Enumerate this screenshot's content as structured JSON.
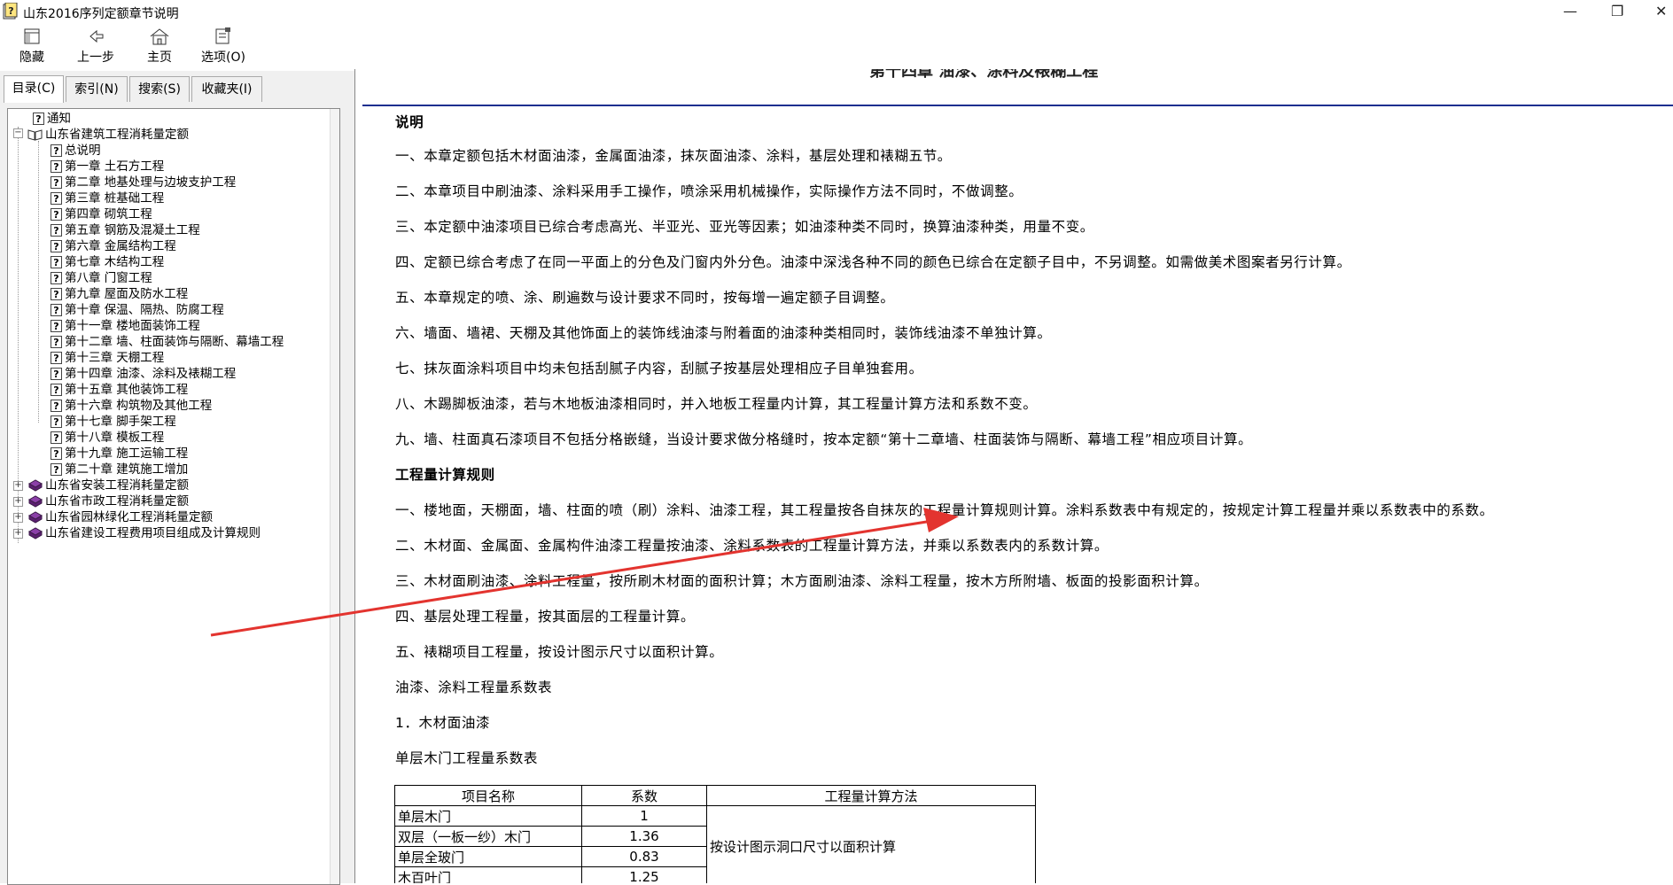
{
  "window": {
    "title": "山东2016序列定额章节说明",
    "controls": {
      "minimize": "—",
      "restore": "❐",
      "close": "✕"
    }
  },
  "toolbar": {
    "buttons": [
      {
        "label": "隐藏",
        "icon": "hide-icon"
      },
      {
        "label": "上一步",
        "icon": "back-arrow-icon"
      },
      {
        "label": "主页",
        "icon": "home-icon"
      },
      {
        "label": "选项(O)",
        "icon": "options-icon"
      }
    ]
  },
  "tabs": [
    "目录(C)",
    "索引(N)",
    "搜索(S)",
    "收藏夹(I)"
  ],
  "tree": {
    "notice": "通知",
    "root_open": "山东省建筑工程消耗量定额",
    "children": [
      "总说明",
      "第一章  土石方工程",
      "第二章  地基处理与边坡支护工程",
      "第三章  桩基础工程",
      "第四章  砌筑工程",
      "第五章  钢筋及混凝土工程",
      "第六章  金属结构工程",
      "第七章  木结构工程",
      "第八章  门窗工程",
      "第九章  屋面及防水工程",
      "第十章  保温、隔热、防腐工程",
      "第十一章  楼地面装饰工程",
      "第十二章  墙、柱面装饰与隔断、幕墙工程",
      "第十三章  天棚工程",
      "第十四章  油漆、涂料及裱糊工程",
      "第十五章  其他装饰工程",
      "第十六章  构筑物及其他工程",
      "第十七章  脚手架工程",
      "第十八章  模板工程",
      "第十九章  施工运输工程",
      "第二十章  建筑施工增加"
    ],
    "roots_closed": [
      "山东省安装工程消耗量定额",
      "山东省市政工程消耗量定额",
      "山东省园林绿化工程消耗量定额",
      "山东省建设工程费用项目组成及计算规则"
    ]
  },
  "doc": {
    "chapter_title": "第十四章  油漆、涂料及裱糊工程",
    "section_explain": "说明",
    "explain_items": [
      "一、本章定额包括木材面油漆，金属面油漆，抹灰面油漆、涂料，基层处理和裱糊五节。",
      "二、本章项目中刷油漆、涂料采用手工操作，喷涂采用机械操作，实际操作方法不同时，不做调整。",
      "三、本定额中油漆项目已综合考虑高光、半亚光、亚光等因素；如油漆种类不同时，换算油漆种类，用量不变。",
      "四、定额已综合考虑了在同一平面上的分色及门窗内外分色。油漆中深浅各种不同的颜色已综合在定额子目中，不另调整。如需做美术图案者另行计算。",
      "五、本章规定的喷、涂、刷遍数与设计要求不同时，按每增一遍定额子目调整。",
      "六、墙面、墙裙、天棚及其他饰面上的装饰线油漆与附着面的油漆种类相同时，装饰线油漆不单独计算。",
      "七、抹灰面涂料项目中均未包括刮腻子内容，刮腻子按基层处理相应子目单独套用。",
      "八、木踢脚板油漆，若与木地板油漆相同时，并入地板工程量内计算，其工程量计算方法和系数不变。",
      "九、墙、柱面真石漆项目不包括分格嵌缝，当设计要求做分格缝时，按本定额“第十二章墙、柱面装饰与隔断、幕墙工程”相应项目计算。"
    ],
    "section_rules": "工程量计算规则",
    "rule_items": [
      "一、楼地面，天棚面，墙、柱面的喷（刷）涂料、油漆工程，其工程量按各自抹灰的工程量计算规则计算。涂料系数表中有规定的，按规定计算工程量并乘以系数表中的系数。",
      "二、木材面、金属面、金属构件油漆工程量按油漆、涂料系数表的工程量计算方法，并乘以系数表内的系数计算。",
      "三、木材面刷油漆、涂料工程量，按所刷木材面的面积计算；木方面刷油漆、涂料工程量，按木方所附墙、板面的投影面积计算。",
      "四、基层处理工程量，按其面层的工程量计算。",
      "五、裱糊项目工程量，按设计图示尺寸以面积计算。"
    ],
    "coef_table_title": "油漆、涂料工程量系数表",
    "sub_title": "1．木材面油漆",
    "table_caption": "单层木门工程量系数表",
    "table": {
      "headers": [
        "项目名称",
        "系数",
        "工程量计算方法"
      ],
      "rows": [
        {
          "name": "单层木门",
          "coef": "1"
        },
        {
          "name": "双层（一板一纱）木门",
          "coef": "1.36"
        },
        {
          "name": "单层全玻门",
          "coef": "0.83"
        },
        {
          "name": "木百叶门",
          "coef": "1.25"
        }
      ],
      "method": "按设计图示洞口尺寸以面积计算"
    }
  },
  "colors": {
    "rule": "#1d2f8f",
    "annotation_arrow": "#e3342f"
  }
}
